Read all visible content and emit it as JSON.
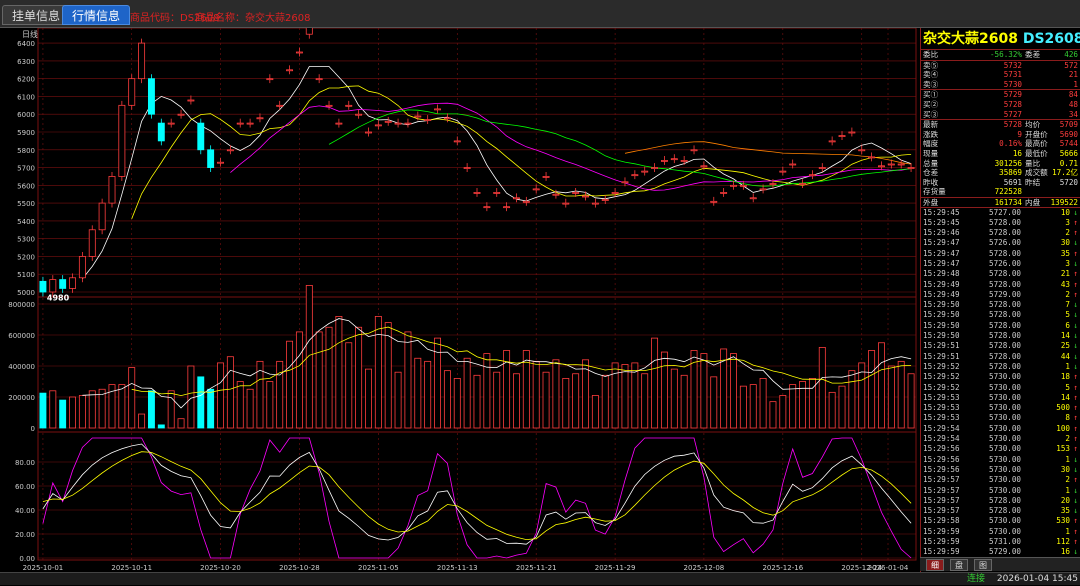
{
  "tabs": {
    "order": "挂单信息",
    "quote": "行情信息"
  },
  "info": {
    "code": "商品代码：DS2608",
    "name": "商品名称：杂交大蒜2608"
  },
  "chart": {
    "period_label": "日线",
    "price_labels": [
      "6400",
      "6300",
      "6200",
      "6100",
      "6000",
      "5900",
      "5800",
      "5700",
      "5600",
      "5500",
      "5400",
      "5300",
      "5200",
      "5100",
      "5000"
    ],
    "vol_labels": [
      "800000",
      "600000",
      "400000",
      "200000",
      "0"
    ],
    "ind_labels": [
      "80.00",
      "60.00",
      "40.00",
      "20.00",
      "0.00"
    ],
    "date_labels": [
      "2025-10-01",
      "2025-10-11",
      "2025-10-20",
      "2025-10-28",
      "2025-11-05",
      "2025-11-13",
      "2025-11-21",
      "2025-11-29",
      "2025-12-08",
      "2025-12-16",
      "2025-12-24",
      "2026-01-04"
    ],
    "high_label": "6493",
    "low_label": "4980"
  },
  "chart_data": {
    "type": "candlestick",
    "open": [
      5060,
      5000,
      5070,
      5020,
      5080,
      5200,
      5350,
      5500,
      5650,
      6050,
      6200,
      6200,
      5950,
      5950,
      6000,
      6080,
      5950,
      5800,
      5730,
      5800,
      5950,
      5950,
      5980,
      6200,
      6050,
      6250,
      6350,
      6450,
      6200,
      6050,
      5950,
      6050,
      6000,
      5900,
      5940,
      5960,
      5950,
      5950,
      5990,
      5970,
      6030,
      5980,
      5850,
      5700,
      5560,
      5480,
      5560,
      5480,
      5530,
      5510,
      5580,
      5650,
      5550,
      5500,
      5560,
      5540,
      5500,
      5520,
      5560,
      5620,
      5660,
      5680,
      5700,
      5740,
      5750,
      5740,
      5800,
      5710,
      5510,
      5560,
      5600,
      5600,
      5530,
      5580,
      5610,
      5680,
      5720,
      5610,
      5660,
      5700,
      5850,
      5880,
      5900,
      5800,
      5760,
      5710,
      5720,
      5720,
      5700
    ],
    "close": [
      5000,
      5070,
      5020,
      5080,
      5200,
      5350,
      5500,
      5650,
      6050,
      6200,
      6400,
      6000,
      5850,
      5950,
      6000,
      6080,
      5800,
      5700,
      5730,
      5800,
      5950,
      5950,
      5980,
      6200,
      6050,
      6250,
      6350,
      6493,
      6200,
      6050,
      5950,
      6050,
      6000,
      5900,
      5940,
      5960,
      5950,
      5950,
      5990,
      5970,
      6030,
      5980,
      5850,
      5700,
      5560,
      5480,
      5560,
      5480,
      5530,
      5510,
      5580,
      5650,
      5550,
      5500,
      5560,
      5540,
      5500,
      5520,
      5560,
      5620,
      5660,
      5680,
      5700,
      5740,
      5750,
      5740,
      5800,
      5710,
      5510,
      5560,
      5600,
      5600,
      5530,
      5580,
      5610,
      5680,
      5720,
      5610,
      5660,
      5700,
      5850,
      5880,
      5900,
      5800,
      5760,
      5710,
      5720,
      5720,
      5700
    ],
    "volume": [
      225000,
      240000,
      180000,
      200000,
      210000,
      240000,
      250000,
      280000,
      280000,
      390000,
      90000,
      240000,
      20000,
      240000,
      60000,
      400000,
      330000,
      250000,
      420000,
      460000,
      300000,
      250000,
      430000,
      300000,
      430000,
      560000,
      620000,
      920000,
      620000,
      650000,
      720000,
      550000,
      650000,
      380000,
      720000,
      680000,
      360000,
      620000,
      450000,
      430000,
      580000,
      370000,
      320000,
      450000,
      340000,
      480000,
      360000,
      500000,
      350000,
      500000,
      430000,
      360000,
      440000,
      320000,
      350000,
      440000,
      210000,
      340000,
      420000,
      410000,
      420000,
      350000,
      580000,
      490000,
      380000,
      340000,
      500000,
      480000,
      330000,
      510000,
      480000,
      270000,
      280000,
      320000,
      170000,
      210000,
      280000,
      300000,
      320000,
      520000,
      230000,
      270000,
      370000,
      420000,
      500000,
      550000,
      400000,
      430000,
      350000
    ]
  },
  "panel": {
    "name": "杂交大蒜2608",
    "code": "DS2608",
    "rows1": [
      [
        "委比",
        "-56.32%",
        "委差",
        "426"
      ]
    ],
    "sells": [
      [
        "卖⑤",
        "5732",
        "",
        "572"
      ],
      [
        "卖④",
        "5731",
        "",
        "21"
      ],
      [
        "卖③",
        "5730",
        "",
        "1"
      ]
    ],
    "buys": [
      [
        "买①",
        "5729",
        "",
        "84"
      ],
      [
        "买②",
        "5728",
        "",
        "48"
      ],
      [
        "买③",
        "5727",
        "",
        "34"
      ]
    ],
    "stats": [
      [
        "最新",
        "5728",
        "均价",
        "5709"
      ],
      [
        "涨跌",
        "9",
        "开盘价",
        "5690"
      ],
      [
        "幅度",
        "0.16%",
        "最高价",
        "5744"
      ],
      [
        "现量",
        "16",
        "最低价",
        "5666"
      ],
      [
        "总量",
        "301256",
        "量比",
        "0.71"
      ],
      [
        "仓差",
        "35869",
        "成交额",
        "17.2亿"
      ],
      [
        "昨收",
        "5691",
        "昨结",
        "5720"
      ],
      [
        "存货量",
        "722528",
        "",
        ""
      ]
    ],
    "inout": [
      "外盘",
      "161734",
      "内盘",
      "139522"
    ],
    "ticks": [
      [
        "15:29:45",
        "5727.00",
        "10",
        "↓"
      ],
      [
        "15:29:45",
        "5728.00",
        "3",
        "↑"
      ],
      [
        "15:29:46",
        "5728.00",
        "2",
        "↑"
      ],
      [
        "15:29:47",
        "5726.00",
        "30",
        "↓"
      ],
      [
        "15:29:47",
        "5728.00",
        "35",
        "↑"
      ],
      [
        "15:29:47",
        "5726.00",
        "3",
        "↓"
      ],
      [
        "15:29:48",
        "5728.00",
        "21",
        "↑"
      ],
      [
        "15:29:49",
        "5728.00",
        "43",
        "↑"
      ],
      [
        "15:29:49",
        "5729.00",
        "2",
        "↑"
      ],
      [
        "15:29:50",
        "5728.00",
        "7",
        "↓"
      ],
      [
        "15:29:50",
        "5728.00",
        "5",
        "↓"
      ],
      [
        "15:29:50",
        "5728.00",
        "6",
        "↓"
      ],
      [
        "15:29:50",
        "5728.00",
        "14",
        "↓"
      ],
      [
        "15:29:51",
        "5728.00",
        "25",
        "↓"
      ],
      [
        "15:29:51",
        "5728.00",
        "44",
        "↓"
      ],
      [
        "15:29:52",
        "5728.00",
        "1",
        "↓"
      ],
      [
        "15:29:52",
        "5730.00",
        "18",
        "↑"
      ],
      [
        "15:29:52",
        "5730.00",
        "5",
        "↑"
      ],
      [
        "15:29:53",
        "5730.00",
        "14",
        "↑"
      ],
      [
        "15:29:53",
        "5730.00",
        "500",
        "↑"
      ],
      [
        "15:29:53",
        "5730.00",
        "8",
        "↑"
      ],
      [
        "15:29:54",
        "5730.00",
        "100",
        "↑"
      ],
      [
        "15:29:54",
        "5730.00",
        "2",
        "↑"
      ],
      [
        "15:29:56",
        "5730.00",
        "153",
        "↑"
      ],
      [
        "15:29:56",
        "5730.00",
        "1",
        "↓"
      ],
      [
        "15:29:56",
        "5730.00",
        "30",
        "↓"
      ],
      [
        "15:29:57",
        "5730.00",
        "2",
        "↑"
      ],
      [
        "15:29:57",
        "5730.00",
        "1",
        "↓"
      ],
      [
        "15:29:57",
        "5728.00",
        "20",
        "↓"
      ],
      [
        "15:29:57",
        "5728.00",
        "35",
        "↓"
      ],
      [
        "15:29:58",
        "5730.00",
        "530",
        "↑"
      ],
      [
        "15:29:59",
        "5730.00",
        "1",
        "↑"
      ],
      [
        "15:29:59",
        "5731.00",
        "112",
        "↑"
      ],
      [
        "15:29:59",
        "5729.00",
        "16",
        "↓"
      ]
    ],
    "tabs": [
      "细",
      "盘",
      "图"
    ]
  },
  "status": {
    "conn": "连接",
    "time": "2026-01-04 15:45"
  },
  "colors": {
    "up": "#ff3d3d",
    "down": "#00ffff",
    "grid": "#7a1010",
    "ma5": "#ffffff",
    "ma10": "#ffff00",
    "ma20": "#ff00ff",
    "ma30": "#00ff00",
    "ma60": "#ff8000"
  }
}
